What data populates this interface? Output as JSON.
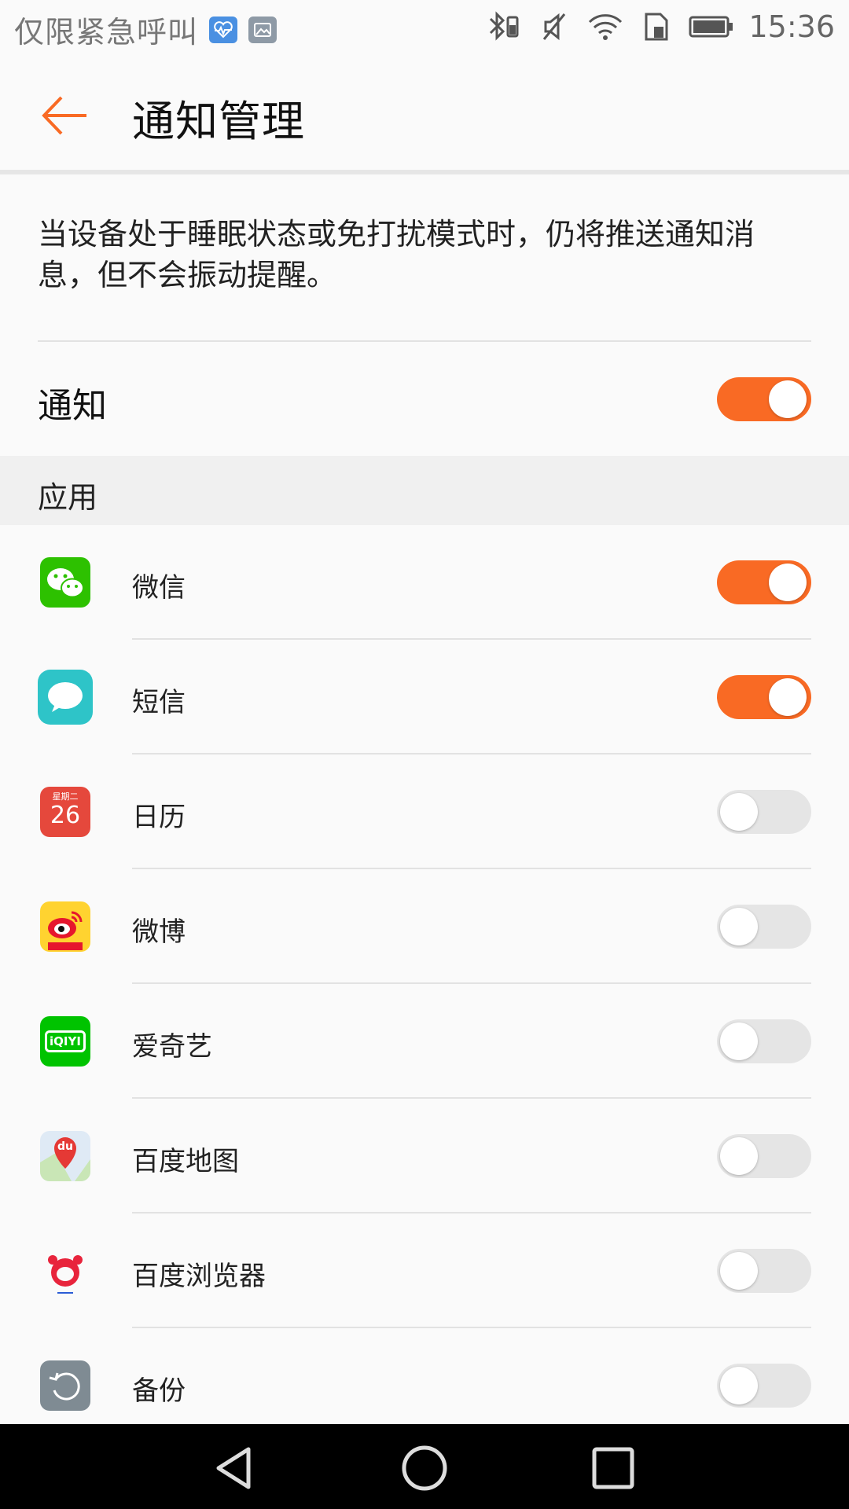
{
  "status_bar": {
    "carrier": "仅限紧急呼叫",
    "time": "15:36",
    "icons": [
      "health-app-icon",
      "gallery-icon",
      "bluetooth-icon",
      "mute-icon",
      "wifi-icon",
      "sim-card-icon",
      "battery-icon"
    ]
  },
  "header": {
    "title": "通知管理",
    "back_icon": "arrow-left-icon"
  },
  "description": "当设备处于睡眠状态或免打扰模式时，仍将推送通知消息，但不会振动提醒。",
  "master_toggle": {
    "label": "通知",
    "on": true
  },
  "section": {
    "title": "应用"
  },
  "apps": [
    {
      "label": "微信",
      "icon": "wechat-icon",
      "on": true
    },
    {
      "label": "短信",
      "icon": "messages-icon",
      "on": true
    },
    {
      "label": "日历",
      "icon": "calendar-icon",
      "on": false,
      "icon_text_top": "星期二",
      "icon_text_day": "26"
    },
    {
      "label": "微博",
      "icon": "weibo-icon",
      "on": false
    },
    {
      "label": "爱奇艺",
      "icon": "iqiyi-icon",
      "on": false,
      "icon_text": "iQIYI"
    },
    {
      "label": "百度地图",
      "icon": "baidu-map-icon",
      "on": false,
      "icon_text": "du"
    },
    {
      "label": "百度浏览器",
      "icon": "baidu-browser-icon",
      "on": false
    },
    {
      "label": "备份",
      "icon": "backup-icon",
      "on": false
    }
  ],
  "colors": {
    "accent": "#f96a24",
    "toggle_off": "#e5e5e5",
    "section_bg": "#f0f0f0"
  },
  "nav": {
    "icons": [
      "nav-back-icon",
      "nav-home-icon",
      "nav-recents-icon"
    ]
  }
}
